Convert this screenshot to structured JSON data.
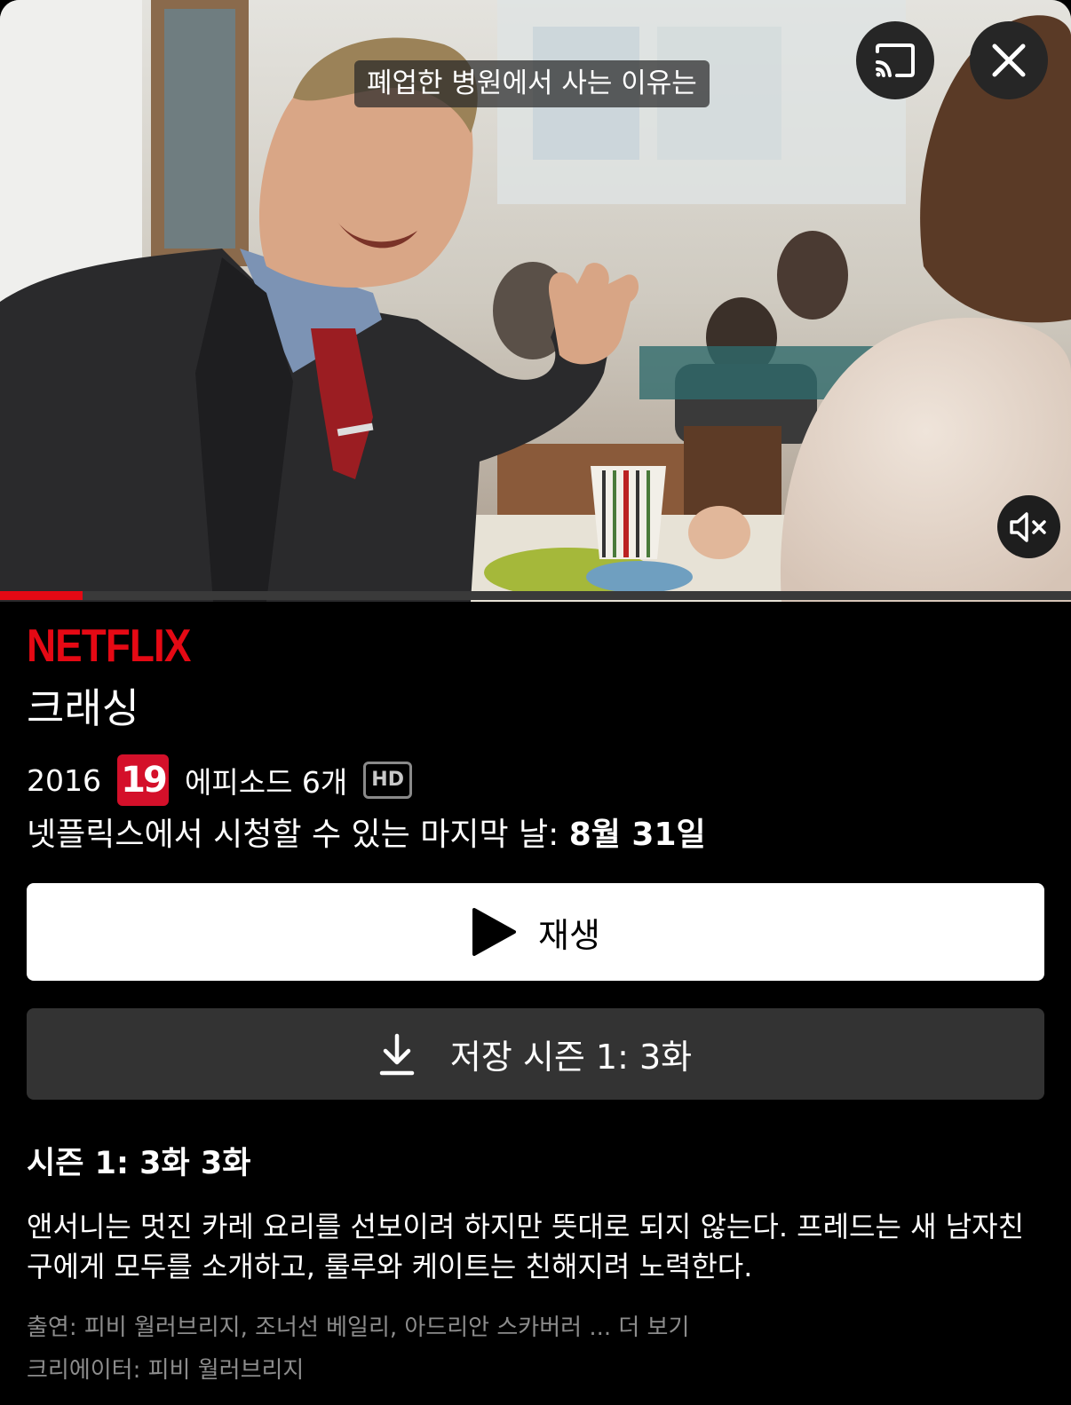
{
  "video": {
    "subtitle": "폐업한 병원에서 사는 이유는",
    "progress": 0.077,
    "cast_icon": "cast-icon",
    "close_icon": "close-icon",
    "mute_icon": "muted-speaker-icon"
  },
  "brand": {
    "logo": "NETFLIX",
    "color": "#e50914"
  },
  "show": {
    "title": "크래싱",
    "year": "2016",
    "rating": "19",
    "episodes": "에피소드 6개",
    "quality": "HD",
    "last_day_label": "넷플릭스에서 시청할 수 있는 마지막 날: ",
    "last_day_date": "8월 31일"
  },
  "actions": {
    "play_label": "재생",
    "download_label": "저장 시즌 1: 3화"
  },
  "episode": {
    "title": "시즌 1: 3화 3화",
    "synopsis": "앤서니는 멋진 카레 요리를 선보이려 하지만 뜻대로 되지 않는다. 프레드는 새 남자친구에게 모두를 소개하고, 룰루와 케이트는 친해지려 노력한다."
  },
  "credits": {
    "cast": "출연: 피비 월러브리지, 조너선 베일리, 아드리안 스카버러 ",
    "more": "... 더 보기",
    "creator": "크리에이터: 피비 월러브리지"
  }
}
